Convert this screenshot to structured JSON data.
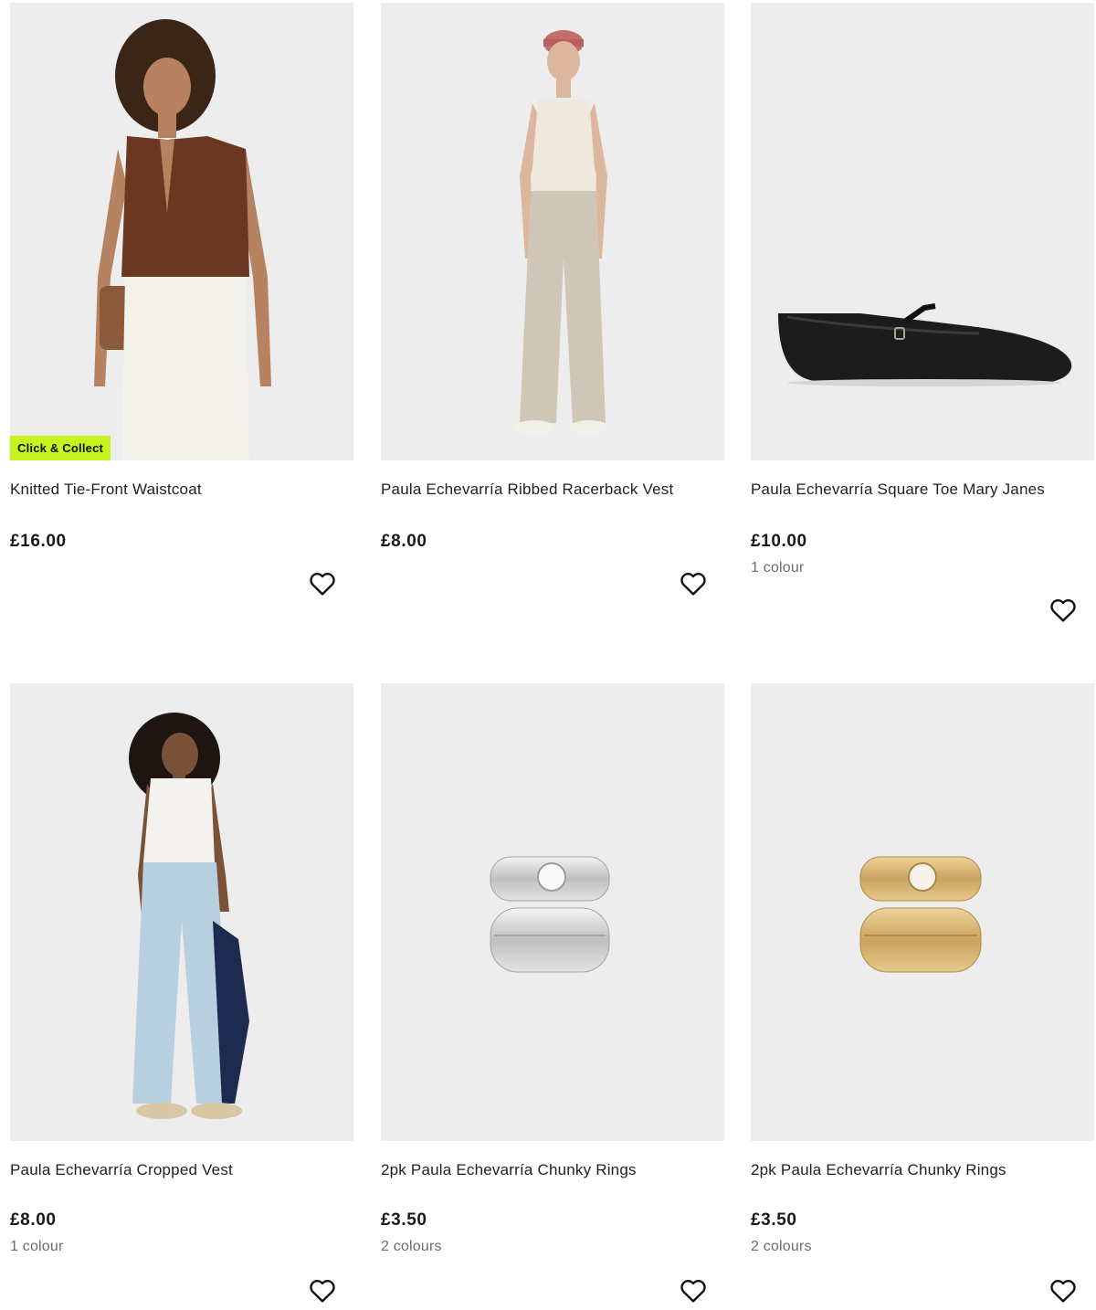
{
  "products": [
    {
      "name": "Knitted Tie-Front Waistcoat",
      "price": "£16.00",
      "colours": "",
      "badge": "Click & Collect",
      "image": "woman-brown-knit-waistcoat"
    },
    {
      "name": "Paula Echevarría Ribbed Racerback Vest",
      "price": "£8.00",
      "colours": "",
      "badge": "",
      "image": "woman-cream-vest-joggers"
    },
    {
      "name": "Paula Echevarría Square Toe Mary Janes",
      "price": "£10.00",
      "colours": "1 colour",
      "badge": "",
      "image": "black-mary-jane-shoe"
    },
    {
      "name": "Paula Echevarría Cropped Vest",
      "price": "£8.00",
      "colours": "1 colour",
      "badge": "",
      "image": "woman-white-vest-jeans"
    },
    {
      "name": "2pk Paula Echevarría Chunky Rings",
      "price": "£3.50",
      "colours": "2 colours",
      "badge": "",
      "image": "silver-chunky-rings"
    },
    {
      "name": "2pk Paula Echevarría Chunky Rings",
      "price": "£3.50",
      "colours": "2 colours",
      "badge": "",
      "image": "gold-chunky-rings"
    }
  ],
  "icons": {
    "favourite": "heart-outline-icon"
  },
  "colors": {
    "badge_bg": "#c6f41f",
    "image_bg": "#ededed",
    "muted_text": "#6b6b6b"
  }
}
